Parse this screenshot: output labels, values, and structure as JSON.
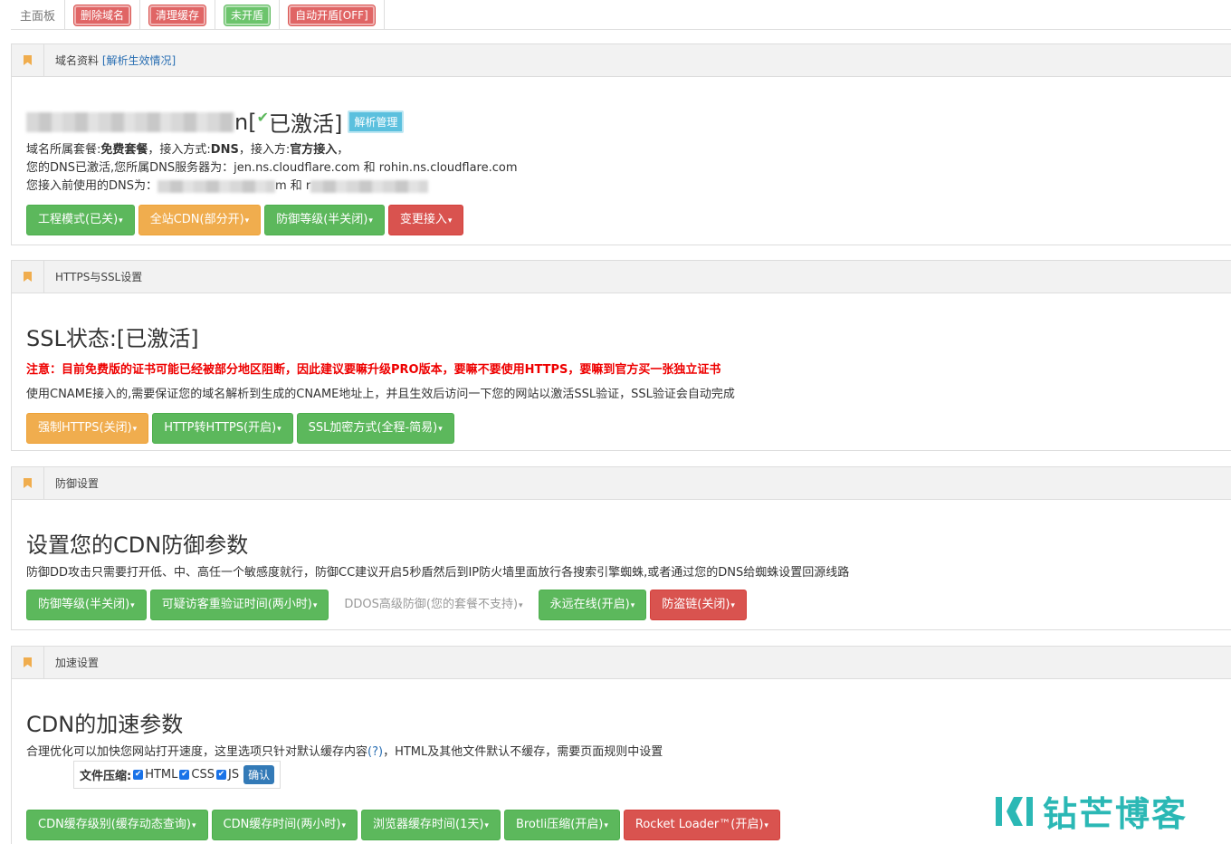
{
  "topbar": {
    "home": "主面板",
    "delete_domain": "删除域名",
    "clear_cache": "清理缓存",
    "shield_off": "未开盾",
    "auto_shield": "自动开盾[OFF]"
  },
  "domain_panel": {
    "title": "域名资料",
    "title_link": "[解析生效情况]",
    "domain_suffix": "n[",
    "activated": "已激活]",
    "dns_manage": "解析管理",
    "plan_prefix": "域名所属套餐:",
    "plan": "免费套餐",
    "method_prefix": "，接入方式:",
    "method": "DNS",
    "access_prefix": "，接入方:",
    "access": "官方接入",
    "access_suffix": "，",
    "dns_line": "您的DNS已激活,您所属DNS服务器为：jen.ns.cloudflare.com 和 rohin.ns.cloudflare.com",
    "prev_dns_prefix": "您接入前使用的DNS为：",
    "prev_dns_mid": "m 和 r",
    "buttons": [
      "工程模式(已关)",
      "全站CDN(部分开)",
      "防御等级(半关闭)",
      "变更接入"
    ]
  },
  "ssl_panel": {
    "title": "HTTPS与SSL设置",
    "heading": "SSL状态:[已激活]",
    "warning": "注意：目前免费版的证书可能已经被部分地区阻断，因此建议要嘛升级PRO版本，要嘛不要使用HTTPS，要嘛到官方买一张独立证书",
    "note": "使用CNAME接入的,需要保证您的域名解析到生成的CNAME地址上，并且生效后访问一下您的网站以激活SSL验证，SSL验证会自动完成",
    "buttons": [
      "强制HTTPS(关闭)",
      "HTTP转HTTPS(开启)",
      "SSL加密方式(全程-简易)"
    ]
  },
  "defense_panel": {
    "title": "防御设置",
    "heading": "设置您的CDN防御参数",
    "note": "防御DD攻击只需要打开低、中、高任一个敏感度就行，防御CC建议开启5秒盾然后到IP防火墙里面放行各搜索引擎蜘蛛,或者通过您的DNS给蜘蛛设置回源线路",
    "buttons": [
      "防御等级(半关闭)",
      "可疑访客重验证时间(两小时)",
      "DDOS高级防御(您的套餐不支持)",
      "永远在线(开启)",
      "防盗链(关闭)"
    ]
  },
  "speed_panel": {
    "title": "加速设置",
    "heading": "CDN的加速参数",
    "note_a": "合理优化可以加快您网站打开速度，这里选项只针对默认缓存内容",
    "note_link": "(?)",
    "note_b": "，HTML及其他文件默认不缓存，需要页面规则中设置",
    "compress_label": "文件压缩:",
    "opt_html": "HTML",
    "opt_css": "CSS",
    "opt_js": "JS",
    "confirm": "确认",
    "buttons": [
      "CDN缓存级别(缓存动态查询)",
      "CDN缓存时间(两小时)",
      "浏览器缓存时间(1天)",
      "Brotli压缩(开启)",
      "Rocket Loader™(开启)"
    ]
  },
  "logo": {
    "text": "钻芒博客"
  },
  "caret": "▾",
  "check": "✔"
}
